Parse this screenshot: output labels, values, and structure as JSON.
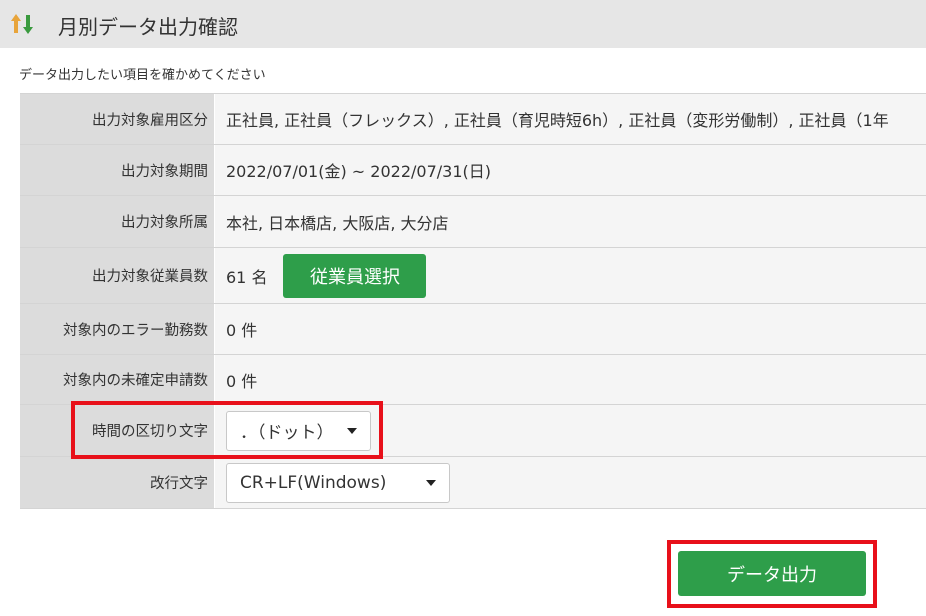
{
  "header": {
    "title": "月別データ出力確認",
    "icon": "sort-arrows-icon"
  },
  "subtitle": "データ出力したい項目を確かめてください",
  "rows": [
    {
      "label": "出力対象雇用区分",
      "value": "正社員, 正社員（フレックス）, 正社員（育児時短6h）, 正社員（変形労働制）, 正社員（1年"
    },
    {
      "label": "出力対象期間",
      "value": "2022/07/01(金) ~ 2022/07/31(日)"
    },
    {
      "label": "出力対象所属",
      "value": "本社, 日本橋店, 大阪店, 大分店"
    },
    {
      "label": "出力対象従業員数",
      "value": "61 名",
      "button": "従業員選択"
    },
    {
      "label": "対象内のエラー勤務数",
      "value": "0 件"
    },
    {
      "label": "対象内の未確定申請数",
      "value": "0 件"
    },
    {
      "label": "時間の区切り文字",
      "select_value": "．（ドット）"
    },
    {
      "label": "改行文字",
      "select_value": "CR+LF(Windows)"
    }
  ],
  "export_button": "データ出力",
  "colors": {
    "accent_green": "#2e9e4a",
    "highlight_red": "#e8101a",
    "header_bg": "#e6e6e6",
    "label_bg": "#dcdcdc"
  }
}
